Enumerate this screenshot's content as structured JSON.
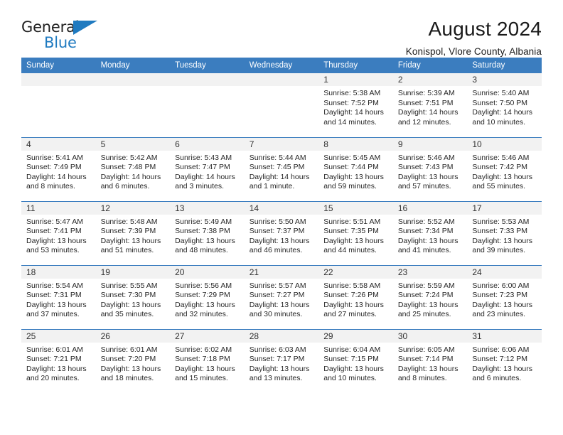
{
  "brand": {
    "name_part1": "General",
    "name_part2": "Blue",
    "triangle_color": "#1f7ac0"
  },
  "header": {
    "title": "August 2024",
    "subtitle": "Konispol, Vlore County, Albania",
    "header_bg_color": "#3b7dbf",
    "daynum_bg_color": "#f2f2f2"
  },
  "weekdays": [
    {
      "label": "Sunday"
    },
    {
      "label": "Monday"
    },
    {
      "label": "Tuesday"
    },
    {
      "label": "Wednesday"
    },
    {
      "label": "Thursday"
    },
    {
      "label": "Friday"
    },
    {
      "label": "Saturday"
    }
  ],
  "weeks": [
    [
      {
        "day": "",
        "empty": true,
        "sunrise": "",
        "sunset": "",
        "daylight1": "",
        "daylight2": ""
      },
      {
        "day": "",
        "empty": true,
        "sunrise": "",
        "sunset": "",
        "daylight1": "",
        "daylight2": ""
      },
      {
        "day": "",
        "empty": true,
        "sunrise": "",
        "sunset": "",
        "daylight1": "",
        "daylight2": ""
      },
      {
        "day": "",
        "empty": true,
        "sunrise": "",
        "sunset": "",
        "daylight1": "",
        "daylight2": ""
      },
      {
        "day": "1",
        "sunrise": "Sunrise: 5:38 AM",
        "sunset": "Sunset: 7:52 PM",
        "daylight1": "Daylight: 14 hours",
        "daylight2": "and 14 minutes."
      },
      {
        "day": "2",
        "sunrise": "Sunrise: 5:39 AM",
        "sunset": "Sunset: 7:51 PM",
        "daylight1": "Daylight: 14 hours",
        "daylight2": "and 12 minutes."
      },
      {
        "day": "3",
        "sunrise": "Sunrise: 5:40 AM",
        "sunset": "Sunset: 7:50 PM",
        "daylight1": "Daylight: 14 hours",
        "daylight2": "and 10 minutes."
      }
    ],
    [
      {
        "day": "4",
        "sunrise": "Sunrise: 5:41 AM",
        "sunset": "Sunset: 7:49 PM",
        "daylight1": "Daylight: 14 hours",
        "daylight2": "and 8 minutes."
      },
      {
        "day": "5",
        "sunrise": "Sunrise: 5:42 AM",
        "sunset": "Sunset: 7:48 PM",
        "daylight1": "Daylight: 14 hours",
        "daylight2": "and 6 minutes."
      },
      {
        "day": "6",
        "sunrise": "Sunrise: 5:43 AM",
        "sunset": "Sunset: 7:47 PM",
        "daylight1": "Daylight: 14 hours",
        "daylight2": "and 3 minutes."
      },
      {
        "day": "7",
        "sunrise": "Sunrise: 5:44 AM",
        "sunset": "Sunset: 7:45 PM",
        "daylight1": "Daylight: 14 hours",
        "daylight2": "and 1 minute."
      },
      {
        "day": "8",
        "sunrise": "Sunrise: 5:45 AM",
        "sunset": "Sunset: 7:44 PM",
        "daylight1": "Daylight: 13 hours",
        "daylight2": "and 59 minutes."
      },
      {
        "day": "9",
        "sunrise": "Sunrise: 5:46 AM",
        "sunset": "Sunset: 7:43 PM",
        "daylight1": "Daylight: 13 hours",
        "daylight2": "and 57 minutes."
      },
      {
        "day": "10",
        "sunrise": "Sunrise: 5:46 AM",
        "sunset": "Sunset: 7:42 PM",
        "daylight1": "Daylight: 13 hours",
        "daylight2": "and 55 minutes."
      }
    ],
    [
      {
        "day": "11",
        "sunrise": "Sunrise: 5:47 AM",
        "sunset": "Sunset: 7:41 PM",
        "daylight1": "Daylight: 13 hours",
        "daylight2": "and 53 minutes."
      },
      {
        "day": "12",
        "sunrise": "Sunrise: 5:48 AM",
        "sunset": "Sunset: 7:39 PM",
        "daylight1": "Daylight: 13 hours",
        "daylight2": "and 51 minutes."
      },
      {
        "day": "13",
        "sunrise": "Sunrise: 5:49 AM",
        "sunset": "Sunset: 7:38 PM",
        "daylight1": "Daylight: 13 hours",
        "daylight2": "and 48 minutes."
      },
      {
        "day": "14",
        "sunrise": "Sunrise: 5:50 AM",
        "sunset": "Sunset: 7:37 PM",
        "daylight1": "Daylight: 13 hours",
        "daylight2": "and 46 minutes."
      },
      {
        "day": "15",
        "sunrise": "Sunrise: 5:51 AM",
        "sunset": "Sunset: 7:35 PM",
        "daylight1": "Daylight: 13 hours",
        "daylight2": "and 44 minutes."
      },
      {
        "day": "16",
        "sunrise": "Sunrise: 5:52 AM",
        "sunset": "Sunset: 7:34 PM",
        "daylight1": "Daylight: 13 hours",
        "daylight2": "and 41 minutes."
      },
      {
        "day": "17",
        "sunrise": "Sunrise: 5:53 AM",
        "sunset": "Sunset: 7:33 PM",
        "daylight1": "Daylight: 13 hours",
        "daylight2": "and 39 minutes."
      }
    ],
    [
      {
        "day": "18",
        "sunrise": "Sunrise: 5:54 AM",
        "sunset": "Sunset: 7:31 PM",
        "daylight1": "Daylight: 13 hours",
        "daylight2": "and 37 minutes."
      },
      {
        "day": "19",
        "sunrise": "Sunrise: 5:55 AM",
        "sunset": "Sunset: 7:30 PM",
        "daylight1": "Daylight: 13 hours",
        "daylight2": "and 35 minutes."
      },
      {
        "day": "20",
        "sunrise": "Sunrise: 5:56 AM",
        "sunset": "Sunset: 7:29 PM",
        "daylight1": "Daylight: 13 hours",
        "daylight2": "and 32 minutes."
      },
      {
        "day": "21",
        "sunrise": "Sunrise: 5:57 AM",
        "sunset": "Sunset: 7:27 PM",
        "daylight1": "Daylight: 13 hours",
        "daylight2": "and 30 minutes."
      },
      {
        "day": "22",
        "sunrise": "Sunrise: 5:58 AM",
        "sunset": "Sunset: 7:26 PM",
        "daylight1": "Daylight: 13 hours",
        "daylight2": "and 27 minutes."
      },
      {
        "day": "23",
        "sunrise": "Sunrise: 5:59 AM",
        "sunset": "Sunset: 7:24 PM",
        "daylight1": "Daylight: 13 hours",
        "daylight2": "and 25 minutes."
      },
      {
        "day": "24",
        "sunrise": "Sunrise: 6:00 AM",
        "sunset": "Sunset: 7:23 PM",
        "daylight1": "Daylight: 13 hours",
        "daylight2": "and 23 minutes."
      }
    ],
    [
      {
        "day": "25",
        "sunrise": "Sunrise: 6:01 AM",
        "sunset": "Sunset: 7:21 PM",
        "daylight1": "Daylight: 13 hours",
        "daylight2": "and 20 minutes."
      },
      {
        "day": "26",
        "sunrise": "Sunrise: 6:01 AM",
        "sunset": "Sunset: 7:20 PM",
        "daylight1": "Daylight: 13 hours",
        "daylight2": "and 18 minutes."
      },
      {
        "day": "27",
        "sunrise": "Sunrise: 6:02 AM",
        "sunset": "Sunset: 7:18 PM",
        "daylight1": "Daylight: 13 hours",
        "daylight2": "and 15 minutes."
      },
      {
        "day": "28",
        "sunrise": "Sunrise: 6:03 AM",
        "sunset": "Sunset: 7:17 PM",
        "daylight1": "Daylight: 13 hours",
        "daylight2": "and 13 minutes."
      },
      {
        "day": "29",
        "sunrise": "Sunrise: 6:04 AM",
        "sunset": "Sunset: 7:15 PM",
        "daylight1": "Daylight: 13 hours",
        "daylight2": "and 10 minutes."
      },
      {
        "day": "30",
        "sunrise": "Sunrise: 6:05 AM",
        "sunset": "Sunset: 7:14 PM",
        "daylight1": "Daylight: 13 hours",
        "daylight2": "and 8 minutes."
      },
      {
        "day": "31",
        "sunrise": "Sunrise: 6:06 AM",
        "sunset": "Sunset: 7:12 PM",
        "daylight1": "Daylight: 13 hours",
        "daylight2": "and 6 minutes."
      }
    ]
  ]
}
